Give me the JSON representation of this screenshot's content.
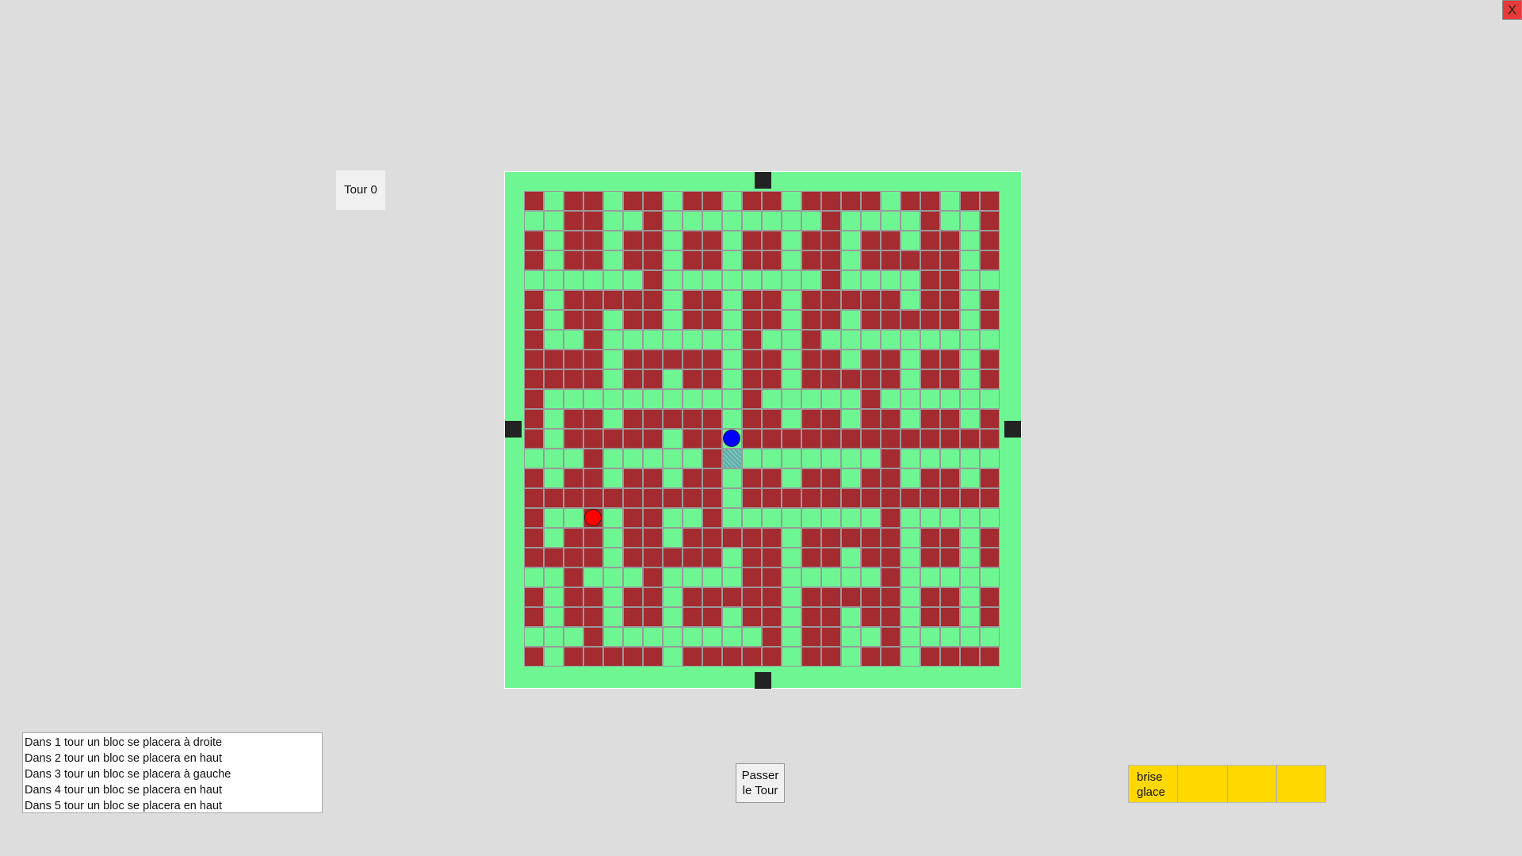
{
  "window": {
    "close_label": "X"
  },
  "turn": {
    "label": "Tour 0"
  },
  "board": {
    "cols": 24,
    "rows": 24,
    "wall_color": "#a42b30",
    "path_color": "#6ef692",
    "cells": [
      "WPWWPWWPWWPWWPWWWWPWWPWW",
      "PPWWPPWPPPPPPPPWPPPPWPPW",
      "WPWWPWWPWWPWWPWWPWWPWWPW",
      "WPWWPWWPWWPWWPWWPWWWWWPW",
      "PPPPPPWPPPPPPPPWPPPPWWPP",
      "WPWWWWWPWWPWWPWWWWWPWWPW",
      "WPWWPWWPWWPWWPWWPWWWWWPW",
      "WPPWPPPPPPPWPPWPPPPPPPPP",
      "WWWWPWWWWWPWWPWWPWWPWWPW",
      "WWWWPWWPWWPWWPWWWWWPWWPW",
      "WPPPPPPPPPPWPPPPPWPPPPPP",
      "WPWWPWWWWWPWWPWWPWWPWWPW",
      "WPWWWWWPWWPWWWWWWWWWWWWW",
      "PPPWPPPPPWHPPPPPPPWPPPPP",
      "WPWWPWWPWWPWWPWWPWWPWWPW",
      "WWWWWWWWWWPWWWWWWWWWWWWW",
      "WPPWPWWPPWPPPPPPPPWPPPPP",
      "WPWWPWWPWWWWWPWWWWWPWWPW",
      "WWWWPWWWWWPWWPWWPWWPWWPW",
      "PPWPPPWPPPPWWPPPPPWPPPPP",
      "WPWWPWWPWWWWWPWWWWWPWWPW",
      "WPWWPWWPWWPWWPWWPWWPWWPW",
      "PPPWPPPPPPPPWPWWPPWPPPPP",
      "WPWWWWWPWWWWWPWWPWWPWWWW"
    ],
    "players": [
      {
        "name": "blue-player",
        "color": "#0000ff",
        "col": 10,
        "row": 12
      },
      {
        "name": "red-player",
        "color": "#ff0000",
        "col": 3,
        "row": 16
      }
    ],
    "exits": [
      "top",
      "left",
      "right",
      "bottom"
    ]
  },
  "log": {
    "lines": [
      "Dans 1 tour un bloc se placera à droite",
      "Dans 2 tour un bloc se placera en haut",
      "Dans 3 tour un bloc se placera à gauche",
      "Dans 4 tour un bloc se placera en haut",
      "Dans 5 tour un bloc se placera en haut"
    ]
  },
  "pass_button": {
    "line1": "Passer",
    "line2": "le Tour"
  },
  "inventory": {
    "color": "#ffd800",
    "slots": [
      {
        "line1": "brise",
        "line2": "glace"
      },
      {
        "line1": "",
        "line2": ""
      },
      {
        "line1": "",
        "line2": ""
      },
      {
        "line1": "",
        "line2": ""
      }
    ]
  }
}
